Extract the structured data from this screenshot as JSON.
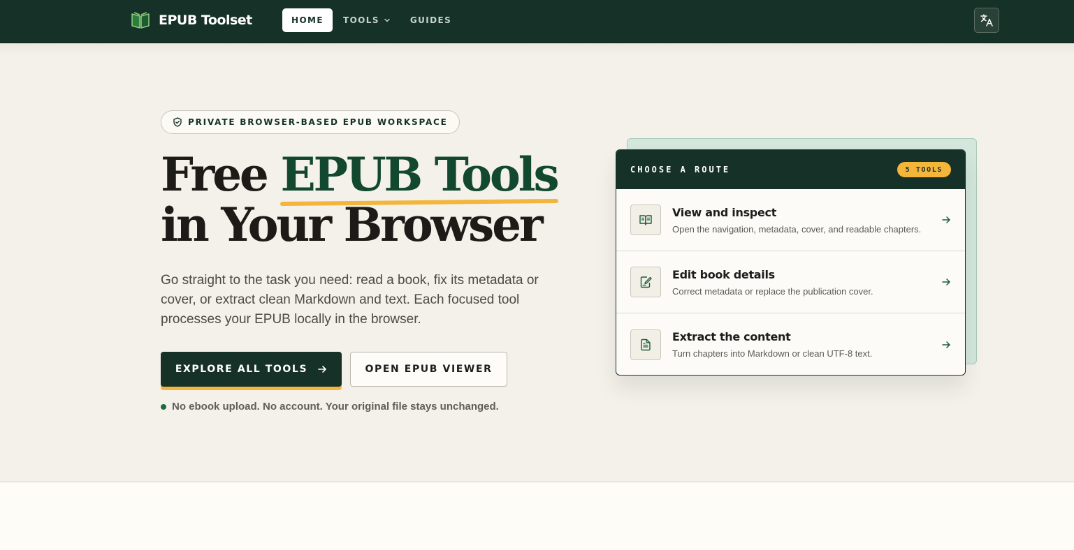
{
  "header": {
    "brand": "EPUB Toolset",
    "logo_icon": "open-book-icon",
    "nav": [
      {
        "label": "HOME",
        "active": true
      },
      {
        "label": "TOOLS",
        "dropdown": true
      },
      {
        "label": "GUIDES"
      }
    ],
    "language_icon": "translate-icon"
  },
  "hero": {
    "badge": "PRIVATE BROWSER-BASED EPUB WORKSPACE",
    "headline_part1": "Free ",
    "headline_accent": "EPUB Tools",
    "headline_line2": "in Your Browser",
    "lead": "Go straight to the task you need: read a book, fix its metadata or cover, or extract clean Markdown and text. Each focused tool processes your EPUB locally in the browser.",
    "primary_cta": "EXPLORE ALL TOOLS",
    "secondary_cta": "OPEN EPUB VIEWER",
    "note": "No ebook upload. No account. Your original file stays unchanged."
  },
  "routes": {
    "title": "CHOOSE A ROUTE",
    "count_badge": "5 TOOLS",
    "items": [
      {
        "title": "View and inspect",
        "desc": "Open the navigation, metadata, cover, and readable chapters.",
        "icon": "book-open-icon"
      },
      {
        "title": "Edit book details",
        "desc": "Correct metadata or replace the publication cover.",
        "icon": "edit-document-icon"
      },
      {
        "title": "Extract the content",
        "desc": "Turn chapters into Markdown or clean UTF-8 text.",
        "icon": "file-text-icon"
      }
    ]
  },
  "colors": {
    "primary": "#163127",
    "accent_green": "#134830",
    "highlight": "#f3b53a",
    "background": "#f4f1ea"
  }
}
